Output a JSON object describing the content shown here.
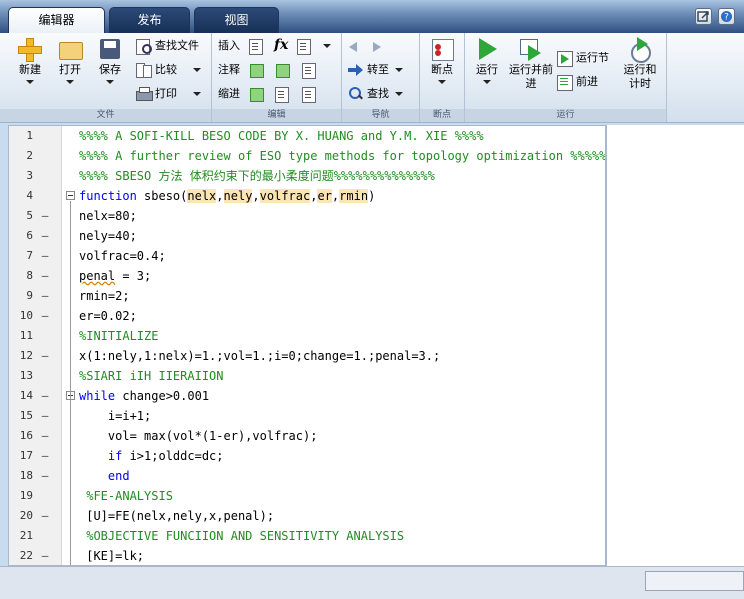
{
  "tabs": [
    {
      "label": "编辑器",
      "active": true
    },
    {
      "label": "发布",
      "active": false
    },
    {
      "label": "视图",
      "active": false
    }
  ],
  "ribbon": {
    "file": {
      "group_label": "文件",
      "new_label": "新建",
      "open_label": "打开",
      "save_label": "保存",
      "find_files_label": "查找文件",
      "compare_label": "比较",
      "print_label": "打印"
    },
    "edit": {
      "group_label": "编辑",
      "insert_label": "插入",
      "comment_label": "注释",
      "indent_label": "缩进",
      "fx_label": "fx"
    },
    "navigate": {
      "group_label": "导航",
      "goto_label": "转至",
      "find_label": "查找"
    },
    "breakpoints": {
      "group_label": "断点",
      "breakpoints_label": "断点"
    },
    "run": {
      "group_label": "运行",
      "run_label": "运行",
      "run_advance_label": "运行并前进",
      "run_section_label": "运行节",
      "advance_label": "前进",
      "run_time_label": "运行和计时"
    }
  },
  "editor": {
    "lines": [
      {
        "n": "1",
        "mark": "",
        "text": "%%%% A SOFI-KILL BESO CODE BY X. HUANG and Y.M. XIE %%%%",
        "type": "comment",
        "indent": 0
      },
      {
        "n": "2",
        "mark": "",
        "text": "%%%% A further review of ESO type methods for topology optimization %%%%%",
        "type": "comment",
        "indent": 0
      },
      {
        "n": "3",
        "mark": "",
        "text": "%%%% SBESO 方法 体积约束下的最小柔度问题%%%%%%%%%%%%%%",
        "type": "comment",
        "indent": 0
      },
      {
        "n": "4",
        "mark": "",
        "text": "function sbeso(nelx,nely,volfrac,er,rmin)",
        "type": "function",
        "indent": 0
      },
      {
        "n": "5",
        "mark": "–",
        "text": "nelx=80;",
        "type": "code",
        "indent": 0
      },
      {
        "n": "6",
        "mark": "–",
        "text": "nely=40;",
        "type": "code",
        "indent": 0
      },
      {
        "n": "7",
        "mark": "–",
        "text": "volfrac=0.4;",
        "type": "code",
        "indent": 0
      },
      {
        "n": "8",
        "mark": "–",
        "text": "penal = 3;",
        "type": "code",
        "indent": 0
      },
      {
        "n": "9",
        "mark": "–",
        "text": "rmin=2;",
        "type": "code",
        "indent": 0
      },
      {
        "n": "10",
        "mark": "–",
        "text": "er=0.02;",
        "type": "code",
        "indent": 0
      },
      {
        "n": "11",
        "mark": "",
        "text": "%INITIALIZE",
        "type": "comment",
        "indent": 0
      },
      {
        "n": "12",
        "mark": "–",
        "text": "x(1:nely,1:nelx)=1.;vol=1.;i=0;change=1.;penal=3.;",
        "type": "code",
        "indent": 0
      },
      {
        "n": "13",
        "mark": "",
        "text": "%SIARI iIH IIERAIION",
        "type": "comment",
        "indent": 0
      },
      {
        "n": "14",
        "mark": "–",
        "text": "while change>0.001",
        "type": "while",
        "indent": 0
      },
      {
        "n": "15",
        "mark": "–",
        "text": "i=i+1;",
        "type": "code",
        "indent": 4
      },
      {
        "n": "16",
        "mark": "–",
        "text": "vol= max(vol*(1-er),volfrac);",
        "type": "code",
        "indent": 4
      },
      {
        "n": "17",
        "mark": "–",
        "text": "if i>1;olddc=dc;",
        "type": "if",
        "indent": 4
      },
      {
        "n": "18",
        "mark": "–",
        "text": "end",
        "type": "end",
        "indent": 4
      },
      {
        "n": "19",
        "mark": "",
        "text": " %FE-ANALYSIS",
        "type": "comment",
        "indent": 0
      },
      {
        "n": "20",
        "mark": "–",
        "text": " [U]=FE(nelx,nely,x,penal);",
        "type": "code",
        "indent": 0
      },
      {
        "n": "21",
        "mark": "",
        "text": " %OBJECTIVE FUNCIION AND SENSITIVITY ANALYSIS",
        "type": "comment",
        "indent": 0
      },
      {
        "n": "22",
        "mark": "–",
        "text": " [KE]=lk;",
        "type": "code",
        "indent": 0
      }
    ]
  },
  "colors": {
    "comment": "#228b22",
    "keyword": "#0000ff",
    "highlight": "#fbe5b4",
    "ribbon_top": "#f9fbfd",
    "tabstrip": "#2f4f7f"
  },
  "icons": {
    "undock": "undock-icon",
    "help": "help-icon"
  }
}
